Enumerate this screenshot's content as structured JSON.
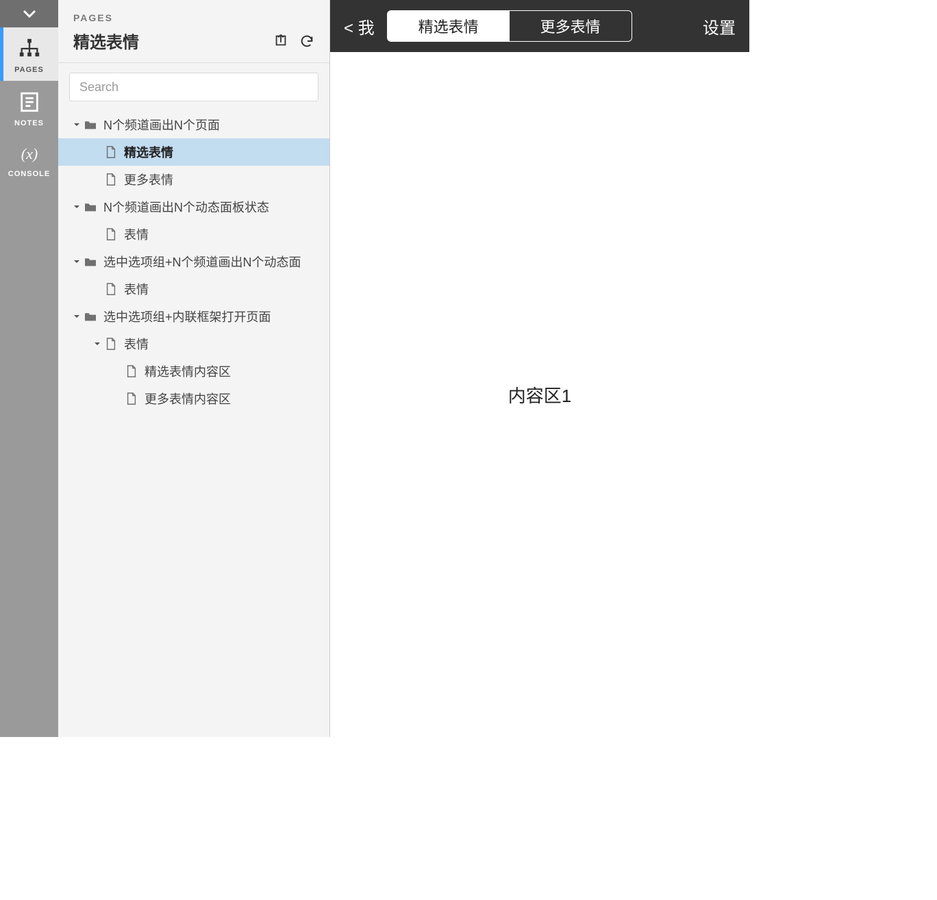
{
  "leftbar": {
    "items": [
      {
        "id": "pages",
        "label": "PAGES",
        "active": true
      },
      {
        "id": "notes",
        "label": "NOTES",
        "active": false
      },
      {
        "id": "console",
        "label": "CONSOLE",
        "active": false
      }
    ]
  },
  "panel": {
    "eyebrow": "PAGES",
    "title": "精选表情",
    "search_placeholder": "Search"
  },
  "tree": [
    {
      "depth": 0,
      "kind": "folder",
      "label": "N个频道画出N个页面",
      "expanded": true,
      "selected": false
    },
    {
      "depth": 1,
      "kind": "page",
      "label": "精选表情",
      "expanded": false,
      "selected": true
    },
    {
      "depth": 1,
      "kind": "page",
      "label": "更多表情",
      "expanded": false,
      "selected": false
    },
    {
      "depth": 0,
      "kind": "folder",
      "label": "N个频道画出N个动态面板状态",
      "expanded": true,
      "selected": false
    },
    {
      "depth": 1,
      "kind": "page",
      "label": "表情",
      "expanded": false,
      "selected": false
    },
    {
      "depth": 0,
      "kind": "folder",
      "label": "选中选项组+N个频道画出N个动态面",
      "expanded": true,
      "selected": false
    },
    {
      "depth": 1,
      "kind": "page",
      "label": "表情",
      "expanded": false,
      "selected": false
    },
    {
      "depth": 0,
      "kind": "folder",
      "label": "选中选项组+内联框架打开页面",
      "expanded": true,
      "selected": false
    },
    {
      "depth": 1,
      "kind": "page",
      "label": "表情",
      "expanded": true,
      "selected": false
    },
    {
      "depth": 2,
      "kind": "page",
      "label": "精选表情内容区",
      "expanded": false,
      "selected": false
    },
    {
      "depth": 2,
      "kind": "page",
      "label": "更多表情内容区",
      "expanded": false,
      "selected": false
    }
  ],
  "preview": {
    "back_label": "< 我",
    "tabs": [
      {
        "label": "精选表情",
        "active": true
      },
      {
        "label": "更多表情",
        "active": false
      }
    ],
    "settings_label": "设置",
    "body_text": "内容区1"
  }
}
